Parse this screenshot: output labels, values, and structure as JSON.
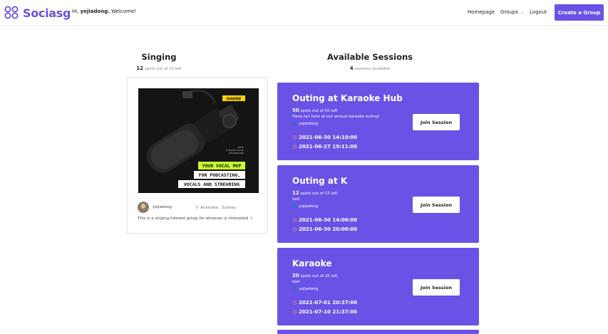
{
  "brand": {
    "name": "Sociasg",
    "color": "#6a52e6"
  },
  "header": {
    "greeting_prefix": "Hi,",
    "username": "yejiadong.",
    "greeting_suffix": "Welcome!",
    "nav": {
      "homepage": "Homepage",
      "groups": "Groups",
      "logout": "Logout"
    },
    "create_group": "Create a Group"
  },
  "group": {
    "title": "Singing",
    "spots_count": "12",
    "spots_text": "spots out of 12 left",
    "image": {
      "brand": "SHURE",
      "tag": "SM7B\nDYNAMIC VOCAL\nMICROPHONE",
      "lines": [
        "YOUR VOCAL MVP",
        "FOR PODCASTING,",
        "VOCALS AND STREAMING"
      ]
    },
    "owner": "yejiadong",
    "location": "Australia , Sydney",
    "description": "This is a singing interest group for whoever is interested :)"
  },
  "sessions_panel": {
    "title": "Available Sessions",
    "count": "4",
    "count_text": "sessions available"
  },
  "sessions": [
    {
      "title": "Outing at Karaoke Hub",
      "spots_count": "50",
      "spots_text": "spots out of 50 left",
      "description": "Have fun here at our annual karaoke outing!",
      "user": "yejiadong",
      "start": "2021-06-30 14:10:00",
      "end": "2021-06-27 19:11:00",
      "join": "Join Session"
    },
    {
      "title": "Outing at K",
      "spots_count": "12",
      "spots_text": "spots out of 12 left",
      "description": "test",
      "user": "yejiadong",
      "start": "2021-06-30 14:06:00",
      "end": "2021-06-30 20:06:00",
      "join": "Join Session"
    },
    {
      "title": "Karaoke",
      "spots_count": "20",
      "spots_text": "spots out of 20 left",
      "description": "test",
      "user": "yejiadong",
      "start": "2021-07-01 20:37:00",
      "end": "2021-07-10 21:37:00",
      "join": "Join Session"
    }
  ]
}
